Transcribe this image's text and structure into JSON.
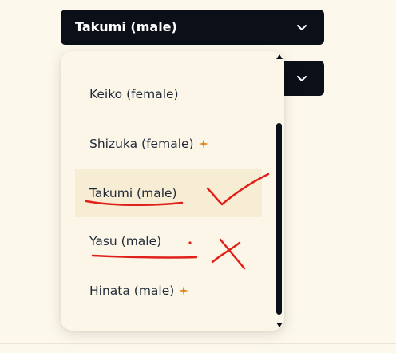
{
  "select_voice": {
    "selected_label": "Takumi (male)"
  },
  "dropdown": {
    "options": [
      {
        "label": "Keiko (female)",
        "sparkle": false
      },
      {
        "label": "Shizuka (female)",
        "sparkle": true
      },
      {
        "label": "Takumi (male)",
        "sparkle": false,
        "selected": true
      },
      {
        "label": "Yasu (male)",
        "sparkle": false
      },
      {
        "label": "Hinata (male)",
        "sparkle": true
      }
    ]
  },
  "colors": {
    "background": "#fdf8ec",
    "select_bg": "#0b0f17",
    "sparkle": "#e08a1e",
    "annotation_red": "#e0201a",
    "selected_row": "#f7ecd4"
  },
  "icons": {
    "chevron": "chevron-down-icon",
    "sparkle": "sparkle-icon"
  }
}
